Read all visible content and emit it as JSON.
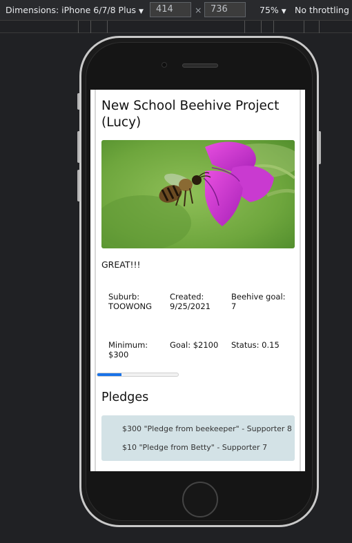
{
  "devtools": {
    "device_label": "Dimensions: iPhone 6/7/8 Plus",
    "width_value": "414",
    "times": "×",
    "height_value": "736",
    "zoom": "75%",
    "throttle": "No throttling"
  },
  "project": {
    "title": "New School Beehive Project (Lucy)",
    "description": "GREAT!!!",
    "stats_row1": [
      {
        "label": "Suburb:",
        "value": "TOOWONG"
      },
      {
        "label": "Created:",
        "value": "9/25/2021"
      },
      {
        "label": "Beehive goal:",
        "value": "7"
      }
    ],
    "stats_row2": [
      {
        "label": "Minimum:",
        "value": "$300"
      },
      {
        "label": "Goal: $2100",
        "value": ""
      },
      {
        "label": "Status: 0.15",
        "value": ""
      }
    ],
    "progress_fraction": 0.3
  },
  "pledges": {
    "heading": "Pledges",
    "items": [
      "$300 \"Pledge from beekeeper\" - Supporter 8",
      "$10 \"Pledge from Betty\" - Supporter 7"
    ]
  }
}
